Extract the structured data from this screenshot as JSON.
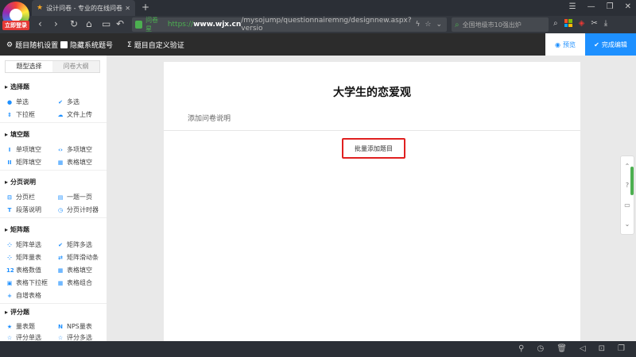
{
  "browser": {
    "login_badge": "立即登录",
    "tab_title": "设计问卷 - 专业的在线问卷",
    "tab_close": "✕",
    "new_tab": "+",
    "url_site_label": "问卷星",
    "url_protocol": "https://",
    "url_domain": "www.wjx.cn",
    "url_path": "/mysojump/questionnairemng/designnew.aspx?versio",
    "search_placeholder": "全国地级市10强出炉"
  },
  "toolbar": {
    "random_settings": "题目随机设置",
    "hide_numbers": "隐藏系统题号",
    "custom_validation": "题目自定义验证",
    "preview": "预览",
    "finish": "完成编辑"
  },
  "sidebar": {
    "tab_types": "题型选择",
    "tab_outline": "问卷大纲",
    "sections": {
      "choice": "选择题",
      "fill": "填空题",
      "paging": "分页说明",
      "matrix": "矩阵题",
      "rating": "评分题"
    },
    "items": {
      "single": "单选",
      "multi": "多选",
      "dropdown": "下拉框",
      "upload": "文件上传",
      "single_fill": "单项填空",
      "multi_fill": "多项填空",
      "matrix_fill": "矩阵填空",
      "table_fill": "表格填空",
      "page_break": "分页栏",
      "one_page": "一题一页",
      "paragraph": "段落说明",
      "timer": "分页计时器",
      "matrix_single": "矩阵单选",
      "matrix_multi": "矩阵多选",
      "matrix_scale": "矩阵量表",
      "matrix_slider": "矩阵滑动条",
      "table_number": "表格数值",
      "table_fill2": "表格填空",
      "table_dropdown": "表格下拉框",
      "table_combo": "表格组合",
      "auto_table": "自增表格",
      "scale": "量表题",
      "nps": "NPS量表",
      "rating_single": "评分单选",
      "rating_multi": "评分多选"
    }
  },
  "survey": {
    "title": "大学生的恋爱观",
    "description_placeholder": "添加问卷说明",
    "batch_add": "批量添加题目"
  },
  "colors": {
    "accent": "#1e90ff",
    "highlight": "#e02020",
    "toolbar_bg": "#2c2c2c"
  }
}
